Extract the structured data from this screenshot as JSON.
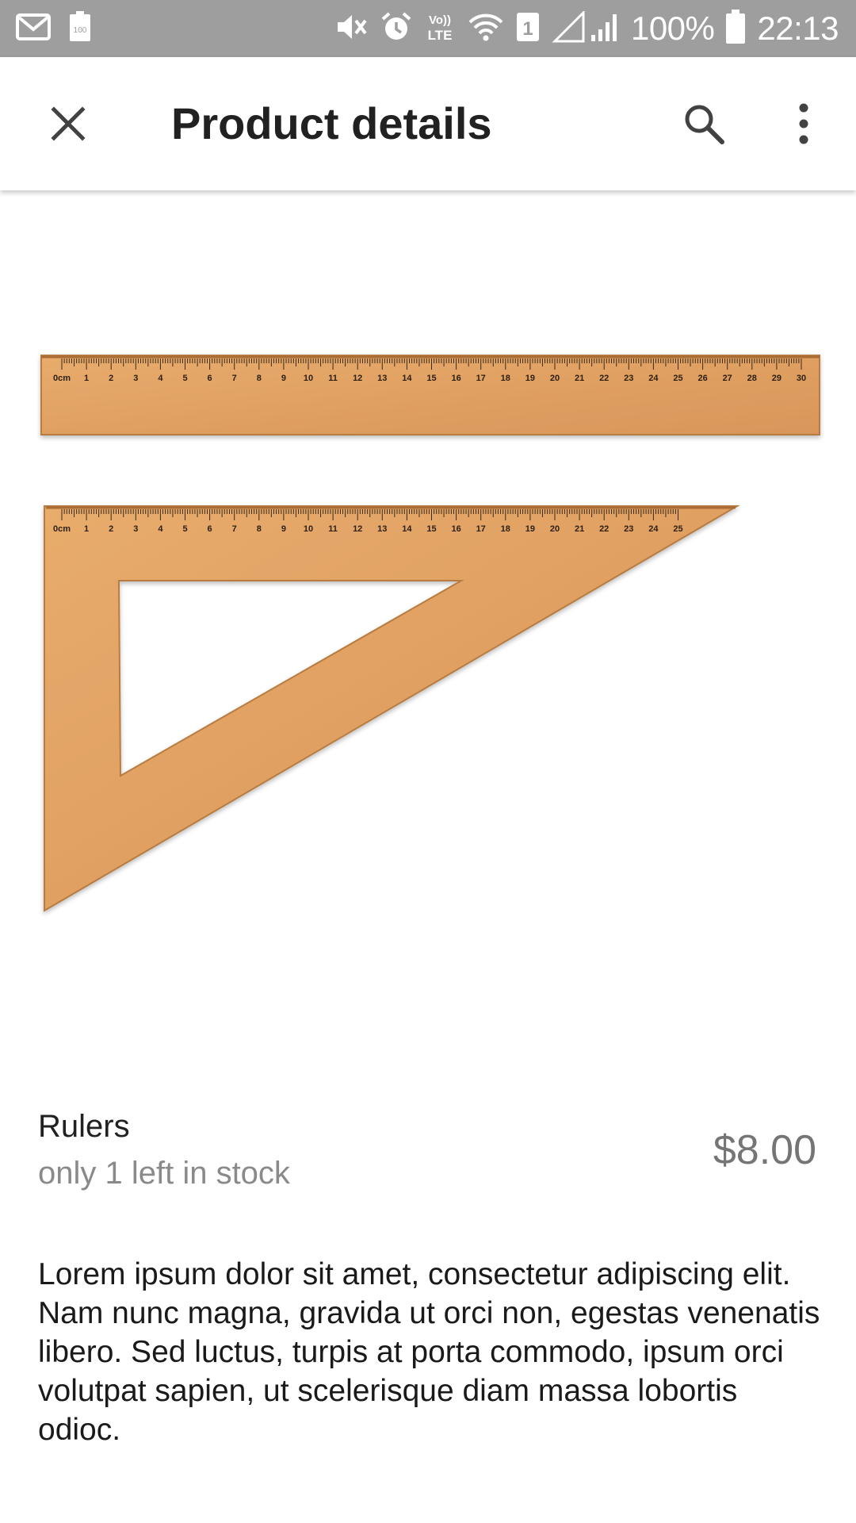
{
  "status_bar": {
    "battery_percent": "100%",
    "time": "22:13",
    "sim_slot": "1",
    "lte_top": "Vo))",
    "lte_bottom": "LTE",
    "small_battery_label": "100",
    "icons": [
      "gmail-icon",
      "battery-small-icon",
      "mute-icon",
      "alarm-icon",
      "volte-icon",
      "wifi-icon",
      "sim-icon",
      "signal-icon",
      "battery-icon"
    ]
  },
  "app_bar": {
    "title": "Product details",
    "icons": [
      "close-icon",
      "search-icon",
      "more-vert-icon"
    ]
  },
  "product": {
    "name": "Rulers",
    "stock": "only 1 left in stock",
    "price": "$8.00",
    "description": "Lorem ipsum dolor sit amet, consectetur adipiscing elit. Nam nunc magna, gravida ut orci non, egestas venenatis libero. Sed luctus, turpis at porta commodo, ipsum orci volutpat sapien, ut scelerisque diam massa lobortis odioc.",
    "image": {
      "straight_ruler_labels": [
        "0cm",
        "1",
        "2",
        "3",
        "4",
        "5",
        "6",
        "7",
        "8",
        "9",
        "10",
        "11",
        "12",
        "13",
        "14",
        "15",
        "16",
        "17",
        "18",
        "19",
        "20",
        "21",
        "22",
        "23",
        "24",
        "25",
        "26",
        "27",
        "28",
        "29",
        "30"
      ],
      "triangle_labels": [
        "0cm",
        "1",
        "2",
        "3",
        "4",
        "5",
        "6",
        "7",
        "8",
        "9",
        "10",
        "11",
        "12",
        "13",
        "14",
        "15",
        "16",
        "17",
        "18",
        "19",
        "20",
        "21",
        "22",
        "23",
        "24",
        "25"
      ]
    }
  },
  "colors": {
    "status_bar": "#9e9e9e",
    "wood": "#e3a565",
    "wood_dark": "#c98744",
    "price": "#757575",
    "stock": "#8a8a8a"
  }
}
